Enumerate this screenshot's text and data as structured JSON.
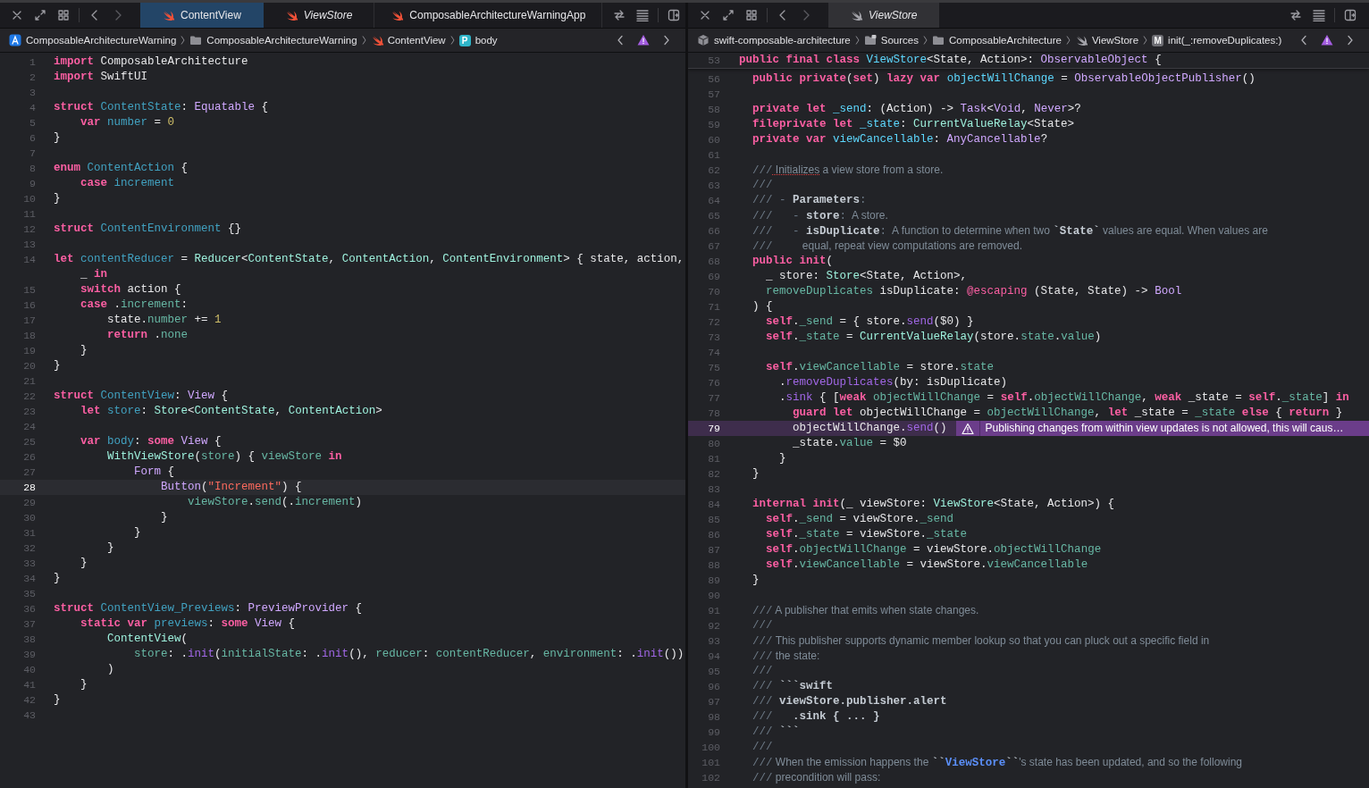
{
  "panes": [
    {
      "focused": true,
      "tabs": [
        {
          "label": "ContentView",
          "kind": "swift",
          "selected": true,
          "preview": false
        },
        {
          "label": "ViewStore",
          "kind": "swift",
          "selected": false,
          "preview": true
        },
        {
          "label": "ComposableArchitectureWarningApp",
          "kind": "swift",
          "selected": false,
          "preview": false
        }
      ],
      "breadcrumbs": [
        {
          "label": "ComposableArchitectureWarning",
          "kind": "app"
        },
        {
          "label": "ComposableArchitectureWarning",
          "kind": "folder"
        },
        {
          "label": "ContentView",
          "kind": "swift"
        },
        {
          "label": "body",
          "kind": "property",
          "badge": "P"
        }
      ],
      "lines": [
        {
          "n": "1",
          "selected": false,
          "tokens": [
            {
              "kind": "keyword",
              "text": "import"
            },
            {
              "kind": "plain",
              "text": " ComposableArchitecture"
            }
          ]
        },
        {
          "n": "2",
          "selected": false,
          "tokens": [
            {
              "kind": "keyword",
              "text": "import"
            },
            {
              "kind": "plain",
              "text": " SwiftUI"
            }
          ]
        },
        {
          "n": "3",
          "selected": false
        },
        {
          "n": "4",
          "selected": false,
          "tokens": [
            {
              "kind": "keyword",
              "text": "struct"
            },
            {
              "kind": "decl",
              "text": " ContentState"
            },
            {
              "kind": "plain",
              "text": ": "
            },
            {
              "kind": "lib",
              "text": "Equatable"
            },
            {
              "kind": "plain",
              "text": " {"
            }
          ]
        },
        {
          "n": "5",
          "selected": false,
          "tokens": [
            {
              "kind": "keyword",
              "text": "    var"
            },
            {
              "kind": "decl",
              "text": " number"
            },
            {
              "kind": "plain",
              "text": " = "
            },
            {
              "kind": "number",
              "text": "0"
            }
          ]
        },
        {
          "n": "6",
          "selected": false,
          "tokens": [
            {
              "kind": "plain",
              "text": "}"
            }
          ]
        },
        {
          "n": "7",
          "selected": false
        },
        {
          "n": "8",
          "selected": false,
          "tokens": [
            {
              "kind": "keyword",
              "text": "enum"
            },
            {
              "kind": "decl",
              "text": " ContentAction"
            },
            {
              "kind": "plain",
              "text": " {"
            }
          ]
        },
        {
          "n": "9",
          "selected": false,
          "tokens": [
            {
              "kind": "keyword",
              "text": "    case"
            },
            {
              "kind": "decl",
              "text": " increment"
            }
          ]
        },
        {
          "n": "10",
          "selected": false,
          "tokens": [
            {
              "kind": "plain",
              "text": "}"
            }
          ]
        },
        {
          "n": "11",
          "selected": false
        },
        {
          "n": "12",
          "selected": false,
          "tokens": [
            {
              "kind": "keyword",
              "text": "struct"
            },
            {
              "kind": "decl",
              "text": " ContentEnvironment"
            },
            {
              "kind": "plain",
              "text": " {}"
            }
          ]
        },
        {
          "n": "13",
          "selected": false
        },
        {
          "n": "14",
          "selected": false,
          "tokens": [
            {
              "kind": "keyword",
              "text": "let"
            },
            {
              "kind": "decl",
              "text": " contentReducer"
            },
            {
              "kind": "plain",
              "text": " = "
            },
            {
              "kind": "type",
              "text": "Reducer"
            },
            {
              "kind": "plain",
              "text": "<"
            },
            {
              "kind": "type",
              "text": "ContentState"
            },
            {
              "kind": "plain",
              "text": ", "
            },
            {
              "kind": "type",
              "text": "ContentAction"
            },
            {
              "kind": "plain",
              "text": ", "
            },
            {
              "kind": "type",
              "text": "ContentEnvironment"
            },
            {
              "kind": "plain",
              "text": "> { state, action,"
            }
          ]
        },
        {
          "selected": false,
          "tokens": [
            {
              "kind": "plain",
              "text": "    _ "
            },
            {
              "kind": "keyword",
              "text": "in"
            }
          ]
        },
        {
          "n": "15",
          "selected": false,
          "tokens": [
            {
              "kind": "keyword",
              "text": "    switch"
            },
            {
              "kind": "plain",
              "text": " action {"
            }
          ]
        },
        {
          "n": "16",
          "selected": false,
          "tokens": [
            {
              "kind": "keyword",
              "text": "    case"
            },
            {
              "kind": "plain",
              "text": " ."
            },
            {
              "kind": "member",
              "text": "increment"
            },
            {
              "kind": "plain",
              "text": ":"
            }
          ]
        },
        {
          "n": "17",
          "selected": false,
          "tokens": [
            {
              "kind": "plain",
              "text": "        state."
            },
            {
              "kind": "member",
              "text": "number"
            },
            {
              "kind": "plain",
              "text": " += "
            },
            {
              "kind": "number",
              "text": "1"
            }
          ]
        },
        {
          "n": "18",
          "selected": false,
          "tokens": [
            {
              "kind": "keyword",
              "text": "        return"
            },
            {
              "kind": "plain",
              "text": " ."
            },
            {
              "kind": "member",
              "text": "none"
            }
          ]
        },
        {
          "n": "19",
          "selected": false,
          "tokens": [
            {
              "kind": "plain",
              "text": "    }"
            }
          ]
        },
        {
          "n": "20",
          "selected": false,
          "tokens": [
            {
              "kind": "plain",
              "text": "}"
            }
          ]
        },
        {
          "n": "21",
          "selected": false
        },
        {
          "n": "22",
          "selected": false,
          "tokens": [
            {
              "kind": "keyword",
              "text": "struct"
            },
            {
              "kind": "decl",
              "text": " ContentView"
            },
            {
              "kind": "plain",
              "text": ": "
            },
            {
              "kind": "lib",
              "text": "View"
            },
            {
              "kind": "plain",
              "text": " {"
            }
          ]
        },
        {
          "n": "23",
          "selected": false,
          "tokens": [
            {
              "kind": "keyword",
              "text": "    let"
            },
            {
              "kind": "decl",
              "text": " store"
            },
            {
              "kind": "plain",
              "text": ": "
            },
            {
              "kind": "type",
              "text": "Store"
            },
            {
              "kind": "plain",
              "text": "<"
            },
            {
              "kind": "type",
              "text": "ContentState"
            },
            {
              "kind": "plain",
              "text": ", "
            },
            {
              "kind": "type",
              "text": "ContentAction"
            },
            {
              "kind": "plain",
              "text": ">"
            }
          ]
        },
        {
          "n": "24",
          "selected": false
        },
        {
          "n": "25",
          "selected": false,
          "tokens": [
            {
              "kind": "keyword",
              "text": "    var"
            },
            {
              "kind": "decl",
              "text": " body"
            },
            {
              "kind": "plain",
              "text": ": "
            },
            {
              "kind": "keyword",
              "text": "some"
            },
            {
              "kind": "lib",
              "text": " View"
            },
            {
              "kind": "plain",
              "text": " {"
            }
          ]
        },
        {
          "n": "26",
          "selected": false,
          "tokens": [
            {
              "kind": "type",
              "text": "        WithViewStore"
            },
            {
              "kind": "plain",
              "text": "("
            },
            {
              "kind": "member",
              "text": "store"
            },
            {
              "kind": "plain",
              "text": ") { "
            },
            {
              "kind": "member",
              "text": "viewStore"
            },
            {
              "kind": "keyword",
              "text": " in"
            }
          ]
        },
        {
          "n": "27",
          "selected": false,
          "tokens": [
            {
              "kind": "lib",
              "text": "            Form"
            },
            {
              "kind": "plain",
              "text": " {"
            }
          ]
        },
        {
          "n": "28",
          "selected": true,
          "tokens": [
            {
              "kind": "lib",
              "text": "                Button"
            },
            {
              "kind": "plain",
              "text": "("
            },
            {
              "kind": "string",
              "text": "\"Increment\""
            },
            {
              "kind": "plain",
              "text": ") {"
            }
          ]
        },
        {
          "n": "29",
          "selected": false,
          "tokens": [
            {
              "kind": "member",
              "text": "                    viewStore"
            },
            {
              "kind": "plain",
              "text": "."
            },
            {
              "kind": "member",
              "text": "send"
            },
            {
              "kind": "plain",
              "text": "(."
            },
            {
              "kind": "member",
              "text": "increment"
            },
            {
              "kind": "plain",
              "text": ")"
            }
          ]
        },
        {
          "n": "30",
          "selected": false,
          "tokens": [
            {
              "kind": "plain",
              "text": "                }"
            }
          ]
        },
        {
          "n": "31",
          "selected": false,
          "tokens": [
            {
              "kind": "plain",
              "text": "            }"
            }
          ]
        },
        {
          "n": "32",
          "selected": false,
          "tokens": [
            {
              "kind": "plain",
              "text": "        }"
            }
          ]
        },
        {
          "n": "33",
          "selected": false,
          "tokens": [
            {
              "kind": "plain",
              "text": "    }"
            }
          ]
        },
        {
          "n": "34",
          "selected": false,
          "tokens": [
            {
              "kind": "plain",
              "text": "}"
            }
          ]
        },
        {
          "n": "35",
          "selected": false
        },
        {
          "n": "36",
          "selected": false,
          "tokens": [
            {
              "kind": "keyword",
              "text": "struct"
            },
            {
              "kind": "decl",
              "text": " ContentView_Previews"
            },
            {
              "kind": "plain",
              "text": ": "
            },
            {
              "kind": "lib",
              "text": "PreviewProvider"
            },
            {
              "kind": "plain",
              "text": " {"
            }
          ]
        },
        {
          "n": "37",
          "selected": false,
          "tokens": [
            {
              "kind": "keyword",
              "text": "    static"
            },
            {
              "kind": "keyword",
              "text": " var"
            },
            {
              "kind": "decl",
              "text": " previews"
            },
            {
              "kind": "plain",
              "text": ": "
            },
            {
              "kind": "keyword",
              "text": "some"
            },
            {
              "kind": "lib",
              "text": " View"
            },
            {
              "kind": "plain",
              "text": " {"
            }
          ]
        },
        {
          "n": "38",
          "selected": false,
          "tokens": [
            {
              "kind": "type",
              "text": "        ContentView"
            },
            {
              "kind": "plain",
              "text": "("
            }
          ]
        },
        {
          "n": "39",
          "selected": false,
          "tokens": [
            {
              "kind": "member",
              "text": "            store"
            },
            {
              "kind": "plain",
              "text": ": ."
            },
            {
              "kind": "call",
              "text": "init"
            },
            {
              "kind": "plain",
              "text": "("
            },
            {
              "kind": "member",
              "text": "initialState"
            },
            {
              "kind": "plain",
              "text": ": ."
            },
            {
              "kind": "call",
              "text": "init"
            },
            {
              "kind": "plain",
              "text": "(), "
            },
            {
              "kind": "member",
              "text": "reducer"
            },
            {
              "kind": "plain",
              "text": ": "
            },
            {
              "kind": "member",
              "text": "contentReducer"
            },
            {
              "kind": "plain",
              "text": ", "
            },
            {
              "kind": "member",
              "text": "environment"
            },
            {
              "kind": "plain",
              "text": ": ."
            },
            {
              "kind": "call",
              "text": "init"
            },
            {
              "kind": "plain",
              "text": "())"
            }
          ]
        },
        {
          "n": "40",
          "selected": false,
          "tokens": [
            {
              "kind": "plain",
              "text": "        )"
            }
          ]
        },
        {
          "n": "41",
          "selected": false,
          "tokens": [
            {
              "kind": "plain",
              "text": "    }"
            }
          ]
        },
        {
          "n": "42",
          "selected": false,
          "tokens": [
            {
              "kind": "plain",
              "text": "}"
            }
          ]
        },
        {
          "n": "43",
          "selected": false
        }
      ]
    },
    {
      "focused": false,
      "tabs": [
        {
          "label": "ViewStore",
          "kind": "swift-muted",
          "selected": true,
          "preview": true
        }
      ],
      "breadcrumbs": [
        {
          "label": "swift-composable-architecture",
          "kind": "package"
        },
        {
          "label": "Sources",
          "kind": "folder-source"
        },
        {
          "label": "ComposableArchitecture",
          "kind": "folder"
        },
        {
          "label": "ViewStore",
          "kind": "swift-muted"
        },
        {
          "label": "init(_:removeDuplicates:)",
          "kind": "method",
          "badge": "M"
        }
      ],
      "sticky_line": {
        "n": "53",
        "selected": false,
        "tokens": [
          {
            "kind": "keyword",
            "text": "public"
          },
          {
            "kind": "keyword",
            "text": " final"
          },
          {
            "kind": "keyword",
            "text": " class"
          },
          {
            "kind": "decl",
            "text": " ViewStore"
          },
          {
            "kind": "plain",
            "text": "<State, Action>: "
          },
          {
            "kind": "lib",
            "text": "ObservableObject"
          },
          {
            "kind": "plain",
            "text": " {"
          }
        ]
      },
      "lines": [
        {
          "n": "56",
          "selected": false,
          "tokens": [
            {
              "kind": "keyword",
              "text": "  public"
            },
            {
              "kind": "keyword",
              "text": " private"
            },
            {
              "kind": "plain",
              "text": "("
            },
            {
              "kind": "keyword",
              "text": "set"
            },
            {
              "kind": "plain",
              "text": ") "
            },
            {
              "kind": "keyword",
              "text": "lazy"
            },
            {
              "kind": "keyword",
              "text": " var"
            },
            {
              "kind": "decl",
              "text": " objectWillChange"
            },
            {
              "kind": "plain",
              "text": " = "
            },
            {
              "kind": "lib",
              "text": "ObservableObjectPublisher"
            },
            {
              "kind": "plain",
              "text": "()"
            }
          ]
        },
        {
          "n": "57",
          "selected": false
        },
        {
          "n": "58",
          "selected": false,
          "tokens": [
            {
              "kind": "keyword",
              "text": "  private"
            },
            {
              "kind": "keyword",
              "text": " let"
            },
            {
              "kind": "decl",
              "text": " _send"
            },
            {
              "kind": "plain",
              "text": ": (Action) -> "
            },
            {
              "kind": "lib",
              "text": "Task"
            },
            {
              "kind": "plain",
              "text": "<"
            },
            {
              "kind": "lib",
              "text": "Void"
            },
            {
              "kind": "plain",
              "text": ", "
            },
            {
              "kind": "lib",
              "text": "Never"
            },
            {
              "kind": "plain",
              "text": ">?"
            }
          ]
        },
        {
          "n": "59",
          "selected": false,
          "tokens": [
            {
              "kind": "keyword",
              "text": "  fileprivate"
            },
            {
              "kind": "keyword",
              "text": " let"
            },
            {
              "kind": "decl",
              "text": " _state"
            },
            {
              "kind": "plain",
              "text": ": "
            },
            {
              "kind": "type",
              "text": "CurrentValueRelay"
            },
            {
              "kind": "plain",
              "text": "<State>"
            }
          ]
        },
        {
          "n": "60",
          "selected": false,
          "tokens": [
            {
              "kind": "keyword",
              "text": "  private"
            },
            {
              "kind": "keyword",
              "text": " var"
            },
            {
              "kind": "decl",
              "text": " viewCancellable"
            },
            {
              "kind": "plain",
              "text": ": "
            },
            {
              "kind": "lib",
              "text": "AnyCancellable"
            },
            {
              "kind": "plain",
              "text": "?"
            }
          ]
        },
        {
          "n": "61",
          "selected": false
        },
        {
          "n": "62",
          "selected": false,
          "tokens": [
            {
              "kind": "mark",
              "text": "  ///"
            },
            {
              "kind": "flagged",
              "text": " Initializes"
            },
            {
              "kind": "prose",
              "text": " a view store from a store."
            }
          ]
        },
        {
          "n": "63",
          "selected": false,
          "tokens": [
            {
              "kind": "mark",
              "text": "  ///"
            }
          ]
        },
        {
          "n": "64",
          "selected": false,
          "tokens": [
            {
              "kind": "mark",
              "text": "  /// - "
            },
            {
              "kind": "bold",
              "text": "Parameters"
            },
            {
              "kind": "mark",
              "text": ":"
            }
          ]
        },
        {
          "n": "65",
          "selected": false,
          "tokens": [
            {
              "kind": "mark",
              "text": "  ///   - "
            },
            {
              "kind": "bold",
              "text": "store"
            },
            {
              "kind": "mark",
              "text": ":"
            },
            {
              "kind": "prose",
              "text": "  A store."
            }
          ]
        },
        {
          "n": "66",
          "selected": false,
          "tokens": [
            {
              "kind": "mark",
              "text": "  ///   - "
            },
            {
              "kind": "bold",
              "text": "isDuplicate"
            },
            {
              "kind": "mark",
              "text": ":"
            },
            {
              "kind": "prose",
              "text": "  A function to determine when two "
            },
            {
              "kind": "bold",
              "text": "`State`"
            },
            {
              "kind": "prose",
              "text": " values are equal. When values are"
            }
          ]
        },
        {
          "n": "67",
          "selected": false,
          "tokens": [
            {
              "kind": "mark",
              "text": "  ///"
            },
            {
              "kind": "prose",
              "text": "          equal, repeat view computations are removed."
            }
          ]
        },
        {
          "n": "68",
          "selected": false,
          "tokens": [
            {
              "kind": "keyword",
              "text": "  public"
            },
            {
              "kind": "keyword",
              "text": " init"
            },
            {
              "kind": "plain",
              "text": "("
            }
          ]
        },
        {
          "n": "69",
          "selected": false,
          "tokens": [
            {
              "kind": "plain",
              "text": "    _ store: "
            },
            {
              "kind": "type",
              "text": "Store"
            },
            {
              "kind": "plain",
              "text": "<State, Action>,"
            }
          ]
        },
        {
          "n": "70",
          "selected": false,
          "tokens": [
            {
              "kind": "member",
              "text": "    removeDuplicates"
            },
            {
              "kind": "plain",
              "text": " isDuplicate: "
            },
            {
              "kind": "attr",
              "text": "@escaping"
            },
            {
              "kind": "plain",
              "text": " (State, State) -> "
            },
            {
              "kind": "lib",
              "text": "Bool"
            }
          ]
        },
        {
          "n": "71",
          "selected": false,
          "tokens": [
            {
              "kind": "plain",
              "text": "  ) {"
            }
          ]
        },
        {
          "n": "72",
          "selected": false,
          "tokens": [
            {
              "kind": "keyword",
              "text": "    self"
            },
            {
              "kind": "plain",
              "text": "."
            },
            {
              "kind": "member",
              "text": "_send"
            },
            {
              "kind": "plain",
              "text": " = { store."
            },
            {
              "kind": "call",
              "text": "send"
            },
            {
              "kind": "plain",
              "text": "($0) }"
            }
          ]
        },
        {
          "n": "73",
          "selected": false,
          "tokens": [
            {
              "kind": "keyword",
              "text": "    self"
            },
            {
              "kind": "plain",
              "text": "."
            },
            {
              "kind": "member",
              "text": "_state"
            },
            {
              "kind": "plain",
              "text": " = "
            },
            {
              "kind": "type",
              "text": "CurrentValueRelay"
            },
            {
              "kind": "plain",
              "text": "(store."
            },
            {
              "kind": "member",
              "text": "state"
            },
            {
              "kind": "plain",
              "text": "."
            },
            {
              "kind": "member",
              "text": "value"
            },
            {
              "kind": "plain",
              "text": ")"
            }
          ]
        },
        {
          "n": "74",
          "selected": false
        },
        {
          "n": "75",
          "selected": false,
          "tokens": [
            {
              "kind": "keyword",
              "text": "    self"
            },
            {
              "kind": "plain",
              "text": "."
            },
            {
              "kind": "member",
              "text": "viewCancellable"
            },
            {
              "kind": "plain",
              "text": " = store."
            },
            {
              "kind": "member",
              "text": "state"
            }
          ]
        },
        {
          "n": "76",
          "selected": false,
          "tokens": [
            {
              "kind": "plain",
              "text": "      ."
            },
            {
              "kind": "call",
              "text": "removeDuplicates"
            },
            {
              "kind": "plain",
              "text": "(by: isDuplicate)"
            }
          ]
        },
        {
          "n": "77",
          "selected": false,
          "tokens": [
            {
              "kind": "plain",
              "text": "      ."
            },
            {
              "kind": "call",
              "text": "sink"
            },
            {
              "kind": "plain",
              "text": " { ["
            },
            {
              "kind": "keyword",
              "text": "weak"
            },
            {
              "kind": "member",
              "text": " objectWillChange"
            },
            {
              "kind": "plain",
              "text": " = "
            },
            {
              "kind": "keyword",
              "text": "self"
            },
            {
              "kind": "plain",
              "text": "."
            },
            {
              "kind": "member",
              "text": "objectWillChange"
            },
            {
              "kind": "plain",
              "text": ", "
            },
            {
              "kind": "keyword",
              "text": "weak"
            },
            {
              "kind": "plain",
              "text": " _state = "
            },
            {
              "kind": "keyword",
              "text": "self"
            },
            {
              "kind": "plain",
              "text": "."
            },
            {
              "kind": "member",
              "text": "_state"
            },
            {
              "kind": "plain",
              "text": "] "
            },
            {
              "kind": "keyword",
              "text": "in"
            }
          ]
        },
        {
          "n": "78",
          "selected": false,
          "tokens": [
            {
              "kind": "keyword",
              "text": "        guard"
            },
            {
              "kind": "keyword",
              "text": " let"
            },
            {
              "kind": "plain",
              "text": " objectWillChange = "
            },
            {
              "kind": "member",
              "text": "objectWillChange"
            },
            {
              "kind": "plain",
              "text": ", "
            },
            {
              "kind": "keyword",
              "text": "let"
            },
            {
              "kind": "plain",
              "text": " _state = "
            },
            {
              "kind": "member",
              "text": "_state"
            },
            {
              "kind": "keyword",
              "text": " else"
            },
            {
              "kind": "plain",
              "text": " { "
            },
            {
              "kind": "keyword",
              "text": "return"
            },
            {
              "kind": "plain",
              "text": " }"
            }
          ]
        },
        {
          "n": "79",
          "selected": true,
          "tokens": [
            {
              "kind": "plain",
              "text": "        objectWillChange."
            },
            {
              "kind": "call",
              "text": "send"
            },
            {
              "kind": "plain",
              "text": "()"
            }
          ],
          "issue": {
            "kind": "warning",
            "text": "Publishing changes from within view updates is not allowed, this will caus…"
          }
        },
        {
          "n": "80",
          "selected": false,
          "tokens": [
            {
              "kind": "plain",
              "text": "        _state."
            },
            {
              "kind": "member",
              "text": "value"
            },
            {
              "kind": "plain",
              "text": " = $0"
            }
          ]
        },
        {
          "n": "81",
          "selected": false,
          "tokens": [
            {
              "kind": "plain",
              "text": "      }"
            }
          ]
        },
        {
          "n": "82",
          "selected": false,
          "tokens": [
            {
              "kind": "plain",
              "text": "  }"
            }
          ]
        },
        {
          "n": "83",
          "selected": false
        },
        {
          "n": "84",
          "selected": false,
          "tokens": [
            {
              "kind": "keyword",
              "text": "  internal"
            },
            {
              "kind": "keyword",
              "text": " init"
            },
            {
              "kind": "plain",
              "text": "(_ viewStore: "
            },
            {
              "kind": "type",
              "text": "ViewStore"
            },
            {
              "kind": "plain",
              "text": "<State, Action>) {"
            }
          ]
        },
        {
          "n": "85",
          "selected": false,
          "tokens": [
            {
              "kind": "keyword",
              "text": "    self"
            },
            {
              "kind": "plain",
              "text": "."
            },
            {
              "kind": "member",
              "text": "_send"
            },
            {
              "kind": "plain",
              "text": " = viewStore."
            },
            {
              "kind": "member",
              "text": "_send"
            }
          ]
        },
        {
          "n": "86",
          "selected": false,
          "tokens": [
            {
              "kind": "keyword",
              "text": "    self"
            },
            {
              "kind": "plain",
              "text": "."
            },
            {
              "kind": "member",
              "text": "_state"
            },
            {
              "kind": "plain",
              "text": " = viewStore."
            },
            {
              "kind": "member",
              "text": "_state"
            }
          ]
        },
        {
          "n": "87",
          "selected": false,
          "tokens": [
            {
              "kind": "keyword",
              "text": "    self"
            },
            {
              "kind": "plain",
              "text": "."
            },
            {
              "kind": "member",
              "text": "objectWillChange"
            },
            {
              "kind": "plain",
              "text": " = viewStore."
            },
            {
              "kind": "member",
              "text": "objectWillChange"
            }
          ]
        },
        {
          "n": "88",
          "selected": false,
          "tokens": [
            {
              "kind": "keyword",
              "text": "    self"
            },
            {
              "kind": "plain",
              "text": "."
            },
            {
              "kind": "member",
              "text": "viewCancellable"
            },
            {
              "kind": "plain",
              "text": " = viewStore."
            },
            {
              "kind": "member",
              "text": "viewCancellable"
            }
          ]
        },
        {
          "n": "89",
          "selected": false,
          "tokens": [
            {
              "kind": "plain",
              "text": "  }"
            }
          ]
        },
        {
          "n": "90",
          "selected": false
        },
        {
          "n": "91",
          "selected": false,
          "tokens": [
            {
              "kind": "mark",
              "text": "  ///"
            },
            {
              "kind": "prose",
              "text": " A publisher that emits when state changes."
            }
          ]
        },
        {
          "n": "92",
          "selected": false,
          "tokens": [
            {
              "kind": "mark",
              "text": "  ///"
            }
          ]
        },
        {
          "n": "93",
          "selected": false,
          "tokens": [
            {
              "kind": "mark",
              "text": "  ///"
            },
            {
              "kind": "prose",
              "text": " This publisher supports dynamic member lookup so that you can pluck out a specific field in"
            }
          ]
        },
        {
          "n": "94",
          "selected": false,
          "tokens": [
            {
              "kind": "mark",
              "text": "  ///"
            },
            {
              "kind": "prose",
              "text": " the state:"
            }
          ]
        },
        {
          "n": "95",
          "selected": false,
          "tokens": [
            {
              "kind": "mark",
              "text": "  ///"
            }
          ]
        },
        {
          "n": "96",
          "selected": false,
          "tokens": [
            {
              "kind": "mark",
              "text": "  ///"
            },
            {
              "kind": "bold",
              "text": " ```swift"
            }
          ]
        },
        {
          "n": "97",
          "selected": false,
          "tokens": [
            {
              "kind": "mark",
              "text": "  ///"
            },
            {
              "kind": "bold",
              "text": " viewStore.publisher.alert"
            }
          ]
        },
        {
          "n": "98",
          "selected": false,
          "tokens": [
            {
              "kind": "mark",
              "text": "  ///"
            },
            {
              "kind": "bold",
              "text": "   .sink { ... }"
            }
          ]
        },
        {
          "n": "99",
          "selected": false,
          "tokens": [
            {
              "kind": "mark",
              "text": "  ///"
            },
            {
              "kind": "bold",
              "text": " ```"
            }
          ]
        },
        {
          "n": "100",
          "selected": false,
          "tokens": [
            {
              "kind": "mark",
              "text": "  ///"
            }
          ]
        },
        {
          "n": "101",
          "selected": false,
          "tokens": [
            {
              "kind": "mark",
              "text": "  ///"
            },
            {
              "kind": "prose",
              "text": " When the emission happens the "
            },
            {
              "kind": "bold",
              "text": "``"
            },
            {
              "kind": "link",
              "text": "ViewStore"
            },
            {
              "kind": "bold",
              "text": "``"
            },
            {
              "kind": "prose",
              "text": "'s state has been updated, and so the following"
            }
          ]
        },
        {
          "n": "102",
          "selected": false,
          "tokens": [
            {
              "kind": "mark",
              "text": "  ///"
            },
            {
              "kind": "prose",
              "text": " precondition will pass:"
            }
          ]
        }
      ]
    }
  ]
}
